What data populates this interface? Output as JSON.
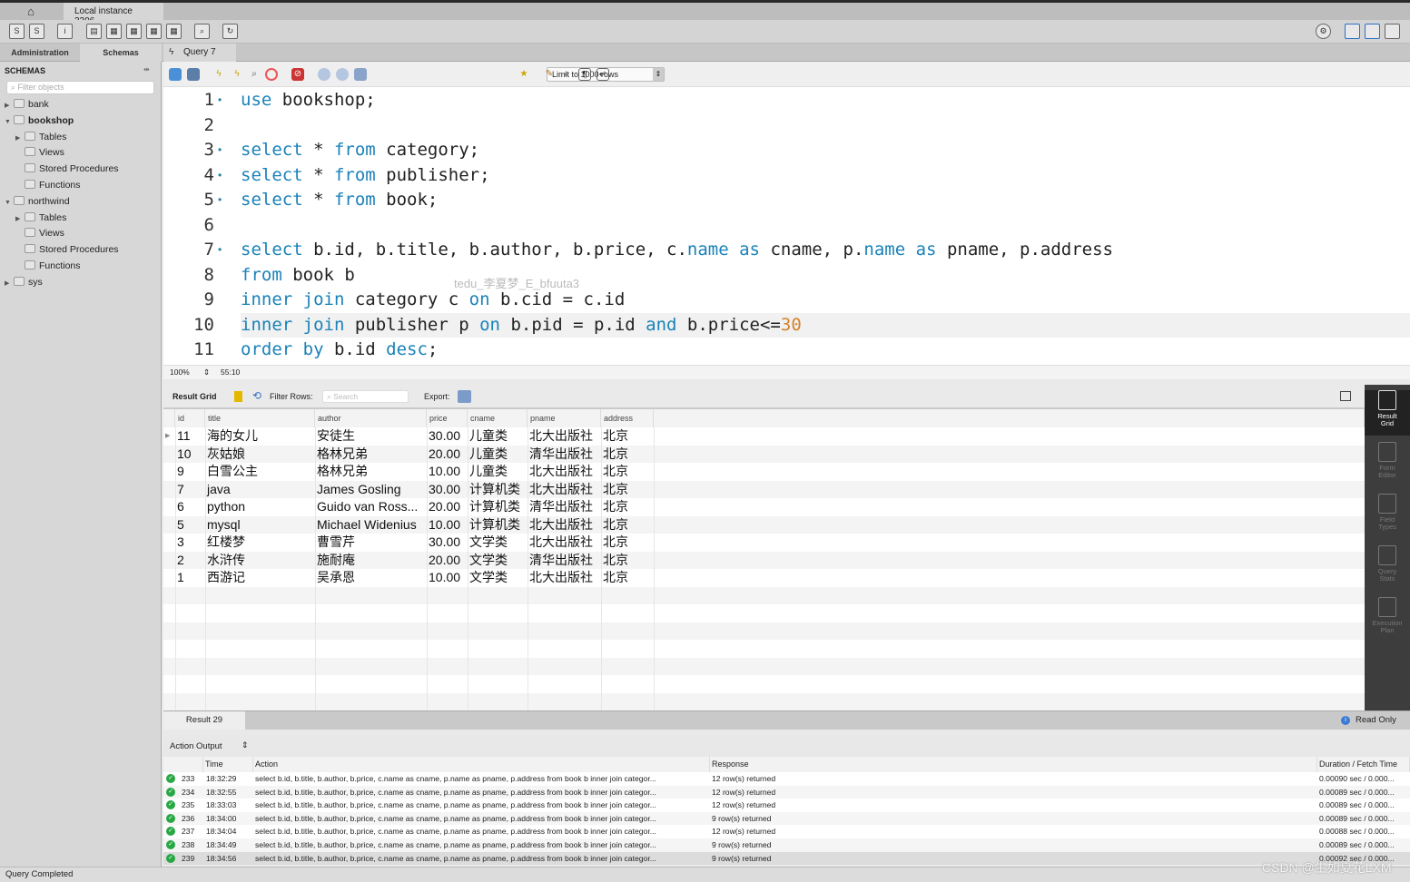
{
  "window": {
    "connection_tab": "Local instance 3306"
  },
  "nav_tabs": {
    "administration": "Administration",
    "schemas": "Schemas",
    "query_tab": "Query 7"
  },
  "sidebar": {
    "title": "SCHEMAS",
    "filter_placeholder": "Filter objects",
    "tree": [
      {
        "label": "bank",
        "level": 0,
        "arrow": "▶",
        "bold": false
      },
      {
        "label": "bookshop",
        "level": 0,
        "arrow": "▼",
        "bold": true
      },
      {
        "label": "Tables",
        "level": 1,
        "arrow": "▶",
        "bold": false
      },
      {
        "label": "Views",
        "level": 1,
        "arrow": "",
        "bold": false
      },
      {
        "label": "Stored Procedures",
        "level": 1,
        "arrow": "",
        "bold": false
      },
      {
        "label": "Functions",
        "level": 1,
        "arrow": "",
        "bold": false
      },
      {
        "label": "northwind",
        "level": 0,
        "arrow": "▼",
        "bold": false
      },
      {
        "label": "Tables",
        "level": 1,
        "arrow": "▶",
        "bold": false
      },
      {
        "label": "Views",
        "level": 1,
        "arrow": "",
        "bold": false
      },
      {
        "label": "Stored Procedures",
        "level": 1,
        "arrow": "",
        "bold": false
      },
      {
        "label": "Functions",
        "level": 1,
        "arrow": "",
        "bold": false
      },
      {
        "label": "sys",
        "level": 0,
        "arrow": "▶",
        "bold": false
      }
    ]
  },
  "editor_toolbar": {
    "limit_select": "Limit to 1000 rows"
  },
  "editor": {
    "lines": [
      {
        "n": "1",
        "dot": true,
        "tokens": [
          [
            "kw",
            "use"
          ],
          [
            "t",
            " bookshop;"
          ]
        ]
      },
      {
        "n": "2",
        "dot": false,
        "tokens": []
      },
      {
        "n": "3",
        "dot": true,
        "tokens": [
          [
            "kw",
            "select"
          ],
          [
            "t",
            " * "
          ],
          [
            "kw",
            "from"
          ],
          [
            "t",
            " category;"
          ]
        ]
      },
      {
        "n": "4",
        "dot": true,
        "tokens": [
          [
            "kw",
            "select"
          ],
          [
            "t",
            " * "
          ],
          [
            "kw",
            "from"
          ],
          [
            "t",
            " publisher;"
          ]
        ]
      },
      {
        "n": "5",
        "dot": true,
        "tokens": [
          [
            "kw",
            "select"
          ],
          [
            "t",
            " * "
          ],
          [
            "kw",
            "from"
          ],
          [
            "t",
            " book;"
          ]
        ]
      },
      {
        "n": "6",
        "dot": false,
        "tokens": []
      },
      {
        "n": "7",
        "dot": true,
        "tokens": [
          [
            "kw",
            "select"
          ],
          [
            "t",
            " b.id, b.title, b.author, b.price, c."
          ],
          [
            "kw",
            "name"
          ],
          [
            "t",
            " "
          ],
          [
            "kw",
            "as"
          ],
          [
            "t",
            " cname, p."
          ],
          [
            "kw",
            "name"
          ],
          [
            "t",
            " "
          ],
          [
            "kw",
            "as"
          ],
          [
            "t",
            " pname, p.address"
          ]
        ]
      },
      {
        "n": "8",
        "dot": false,
        "tokens": [
          [
            "kw",
            "from"
          ],
          [
            "t",
            " book b"
          ]
        ]
      },
      {
        "n": "9",
        "dot": false,
        "tokens": [
          [
            "kw",
            "inner join"
          ],
          [
            "t",
            " category c "
          ],
          [
            "kw",
            "on"
          ],
          [
            "t",
            " b.cid = c.id"
          ]
        ]
      },
      {
        "n": "10",
        "dot": false,
        "tokens": [
          [
            "kw",
            "inner join"
          ],
          [
            "t",
            " publisher p "
          ],
          [
            "kw",
            "on"
          ],
          [
            "t",
            " b.pid = p.id "
          ],
          [
            "kw",
            "and"
          ],
          [
            "t",
            " b.price<="
          ],
          [
            "num",
            "30"
          ]
        ]
      },
      {
        "n": "11",
        "dot": false,
        "tokens": [
          [
            "kw",
            "order by"
          ],
          [
            "t",
            " b.id "
          ],
          [
            "kw",
            "desc"
          ],
          [
            "t",
            ";"
          ]
        ]
      }
    ],
    "watermark": "tedu_李夏梦_E_bfuuta3",
    "zoom": "100%",
    "cursor_pos": "55:10"
  },
  "result_toolbar": {
    "result_grid": "Result Grid",
    "filter_rows": "Filter Rows:",
    "search_placeholder": "Search",
    "export": "Export:"
  },
  "grid": {
    "columns": [
      "id",
      "title",
      "author",
      "price",
      "cname",
      "pname",
      "address"
    ],
    "rows": [
      [
        "11",
        "海的女儿",
        "安徒生",
        "30.00",
        "儿童类",
        "北大出版社",
        "北京"
      ],
      [
        "10",
        "灰姑娘",
        "格林兄弟",
        "20.00",
        "儿童类",
        "清华出版社",
        "北京"
      ],
      [
        "9",
        "白雪公主",
        "格林兄弟",
        "10.00",
        "儿童类",
        "北大出版社",
        "北京"
      ],
      [
        "7",
        "java",
        "James Gosling",
        "30.00",
        "计算机类",
        "北大出版社",
        "北京"
      ],
      [
        "6",
        "python",
        "Guido van Ross...",
        "20.00",
        "计算机类",
        "清华出版社",
        "北京"
      ],
      [
        "5",
        "mysql",
        "Michael Widenius",
        "10.00",
        "计算机类",
        "北大出版社",
        "北京"
      ],
      [
        "3",
        "红楼梦",
        "曹雪芹",
        "30.00",
        "文学类",
        "北大出版社",
        "北京"
      ],
      [
        "2",
        "水浒传",
        "施耐庵",
        "20.00",
        "文学类",
        "清华出版社",
        "北京"
      ],
      [
        "1",
        "西游记",
        "吴承恩",
        "10.00",
        "文学类",
        "北大出版社",
        "北京"
      ]
    ]
  },
  "right_panel": [
    {
      "l1": "Result",
      "l2": "Grid"
    },
    {
      "l1": "Form",
      "l2": "Editor"
    },
    {
      "l1": "Field",
      "l2": "Types"
    },
    {
      "l1": "Query",
      "l2": "Stats"
    },
    {
      "l1": "Execution",
      "l2": "Plan"
    }
  ],
  "result_tabs": {
    "tab": "Result 29",
    "read_only": "Read Only"
  },
  "action_output": {
    "selector": "Action Output",
    "columns": [
      "",
      "Time",
      "Action",
      "Response",
      "Duration / Fetch Time"
    ],
    "rows": [
      [
        "233",
        "18:32:29",
        "select b.id, b.title, b.author, b.price, c.name as cname, p.name as pname, p.address from book b inner join categor...",
        "12 row(s) returned",
        "0.00090 sec / 0.000..."
      ],
      [
        "234",
        "18:32:55",
        "select b.id, b.title, b.author, b.price, c.name as cname, p.name as pname, p.address from book b inner join categor...",
        "12 row(s) returned",
        "0.00089 sec / 0.000..."
      ],
      [
        "235",
        "18:33:03",
        "select b.id, b.title, b.author, b.price, c.name as cname, p.name as pname, p.address from book b inner join categor...",
        "12 row(s) returned",
        "0.00089 sec / 0.000..."
      ],
      [
        "236",
        "18:34:00",
        "select b.id, b.title, b.author, b.price, c.name as cname, p.name as pname, p.address from book b inner join categor...",
        "9 row(s) returned",
        "0.00089 sec / 0.000..."
      ],
      [
        "237",
        "18:34:04",
        "select b.id, b.title, b.author, b.price, c.name as cname, p.name as pname, p.address from book b inner join categor...",
        "12 row(s) returned",
        "0.00088 sec / 0.000..."
      ],
      [
        "238",
        "18:34:49",
        "select b.id, b.title, b.author, b.price, c.name as cname, p.name as pname, p.address from book b inner join categor...",
        "9 row(s) returned",
        "0.00089 sec / 0.000..."
      ],
      [
        "239",
        "18:34:56",
        "select b.id, b.title, b.author, b.price, c.name as cname, p.name as pname, p.address from book b inner join categor...",
        "9 row(s) returned",
        "0.00092 sec / 0.000..."
      ]
    ]
  },
  "statusbar": {
    "text": "Query Completed"
  },
  "watermark": "CSDN @生如夏花LXM",
  "colors": {
    "keyword": "#1a82b8",
    "number": "#d2822a",
    "success": "#28a745",
    "side_panel": "#3d3d3d"
  }
}
